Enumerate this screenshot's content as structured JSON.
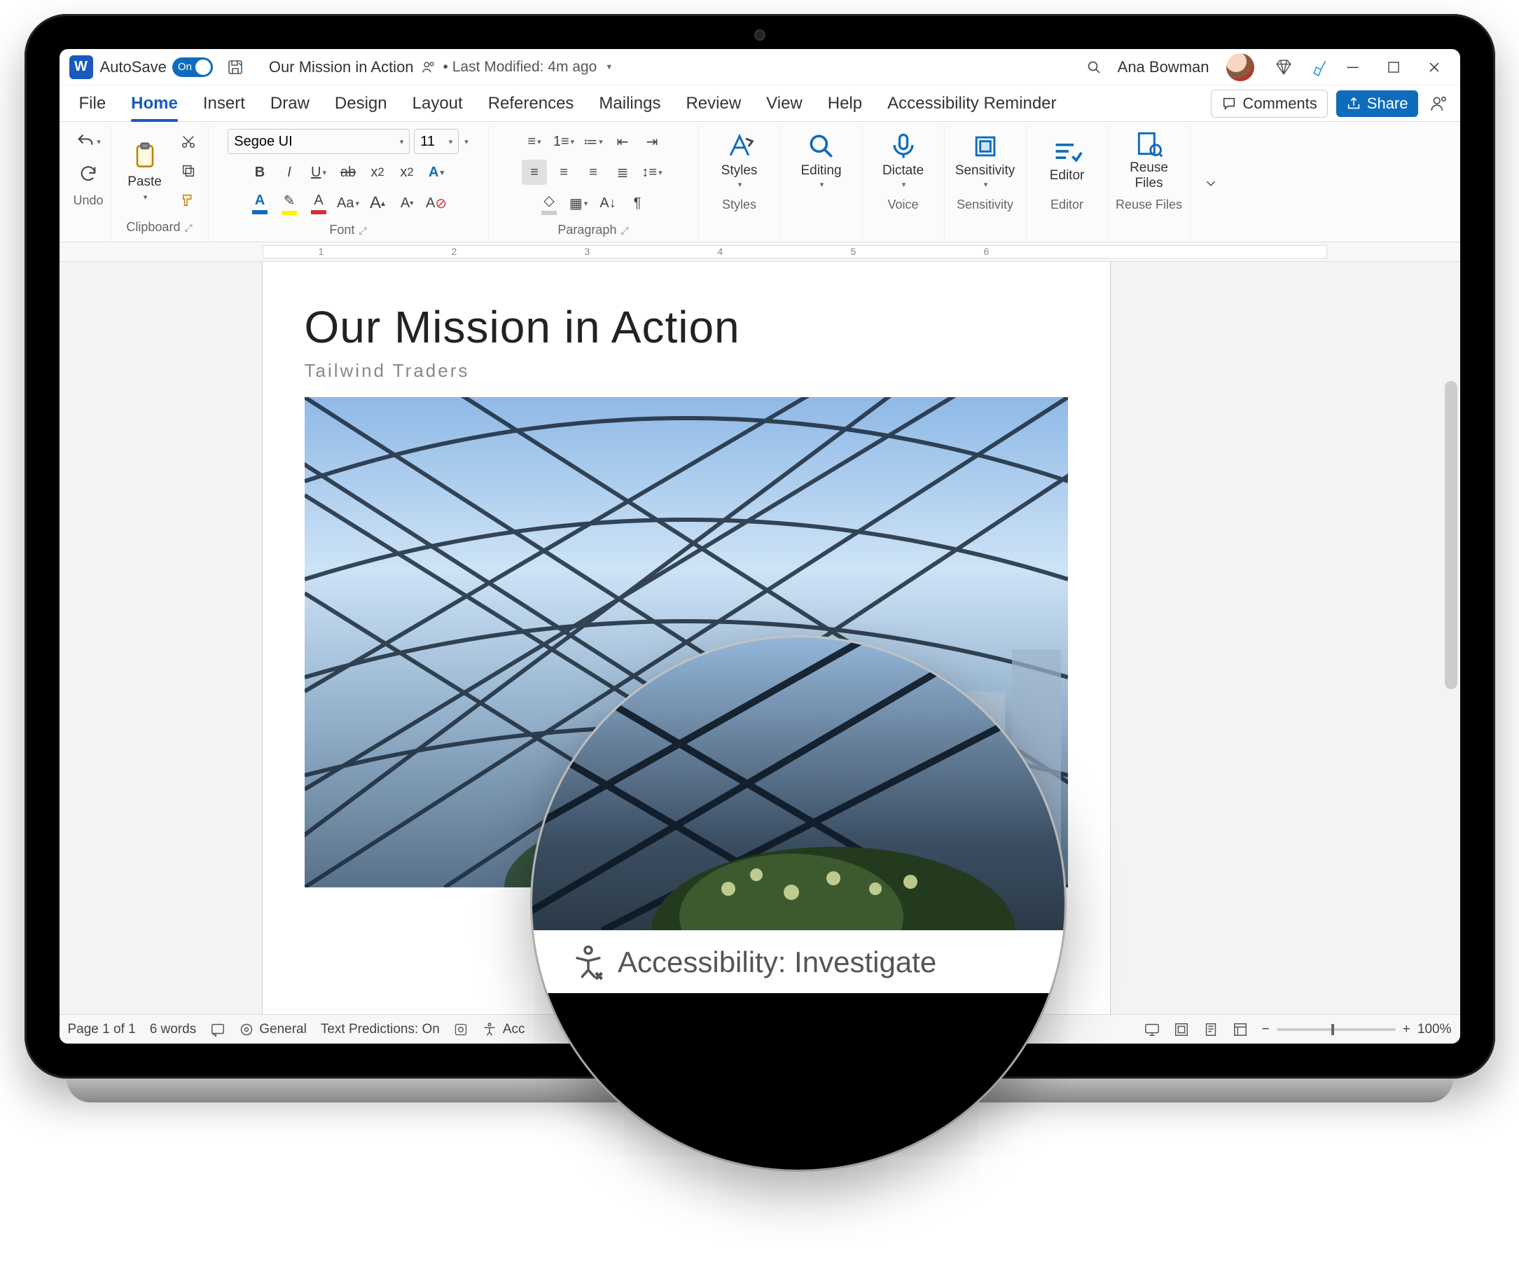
{
  "titlebar": {
    "autosave_label": "AutoSave",
    "autosave_state": "On",
    "doc_title": "Our Mission in Action",
    "last_modified": "• Last Modified: 4m ago",
    "user_name": "Ana Bowman"
  },
  "tabs": {
    "items": [
      "File",
      "Home",
      "Insert",
      "Draw",
      "Design",
      "Layout",
      "References",
      "Mailings",
      "Review",
      "View",
      "Help",
      "Accessibility Reminder"
    ],
    "active": "Home",
    "comments": "Comments",
    "share": "Share"
  },
  "ribbon": {
    "undo_label": "Undo",
    "clipboard_label": "Clipboard",
    "paste": "Paste",
    "font_label": "Font",
    "font_name": "Segoe UI",
    "font_size": "11",
    "paragraph_label": "Paragraph",
    "styles_label": "Styles",
    "styles": "Styles",
    "editing": "Editing",
    "dictate": "Dictate",
    "voice_label": "Voice",
    "sensitivity": "Sensitivity",
    "sensitivity_label": "Sensitivity",
    "editor": "Editor",
    "editor_label": "Editor",
    "reuse": "Reuse\nFiles",
    "reuse_label": "Reuse Files"
  },
  "ruler": {
    "marks": [
      "1",
      "2",
      "3",
      "4",
      "5",
      "6"
    ]
  },
  "document": {
    "heading": "Our Mission in Action",
    "subtitle": "Tailwind Traders"
  },
  "status": {
    "page": "Page 1 of 1",
    "words": "6 words",
    "focus": "General",
    "predictions": "Text Predictions: On",
    "accessibility_short": "Acc",
    "zoom": "100%"
  },
  "magnifier": {
    "text": "Accessibility: Investigate"
  }
}
